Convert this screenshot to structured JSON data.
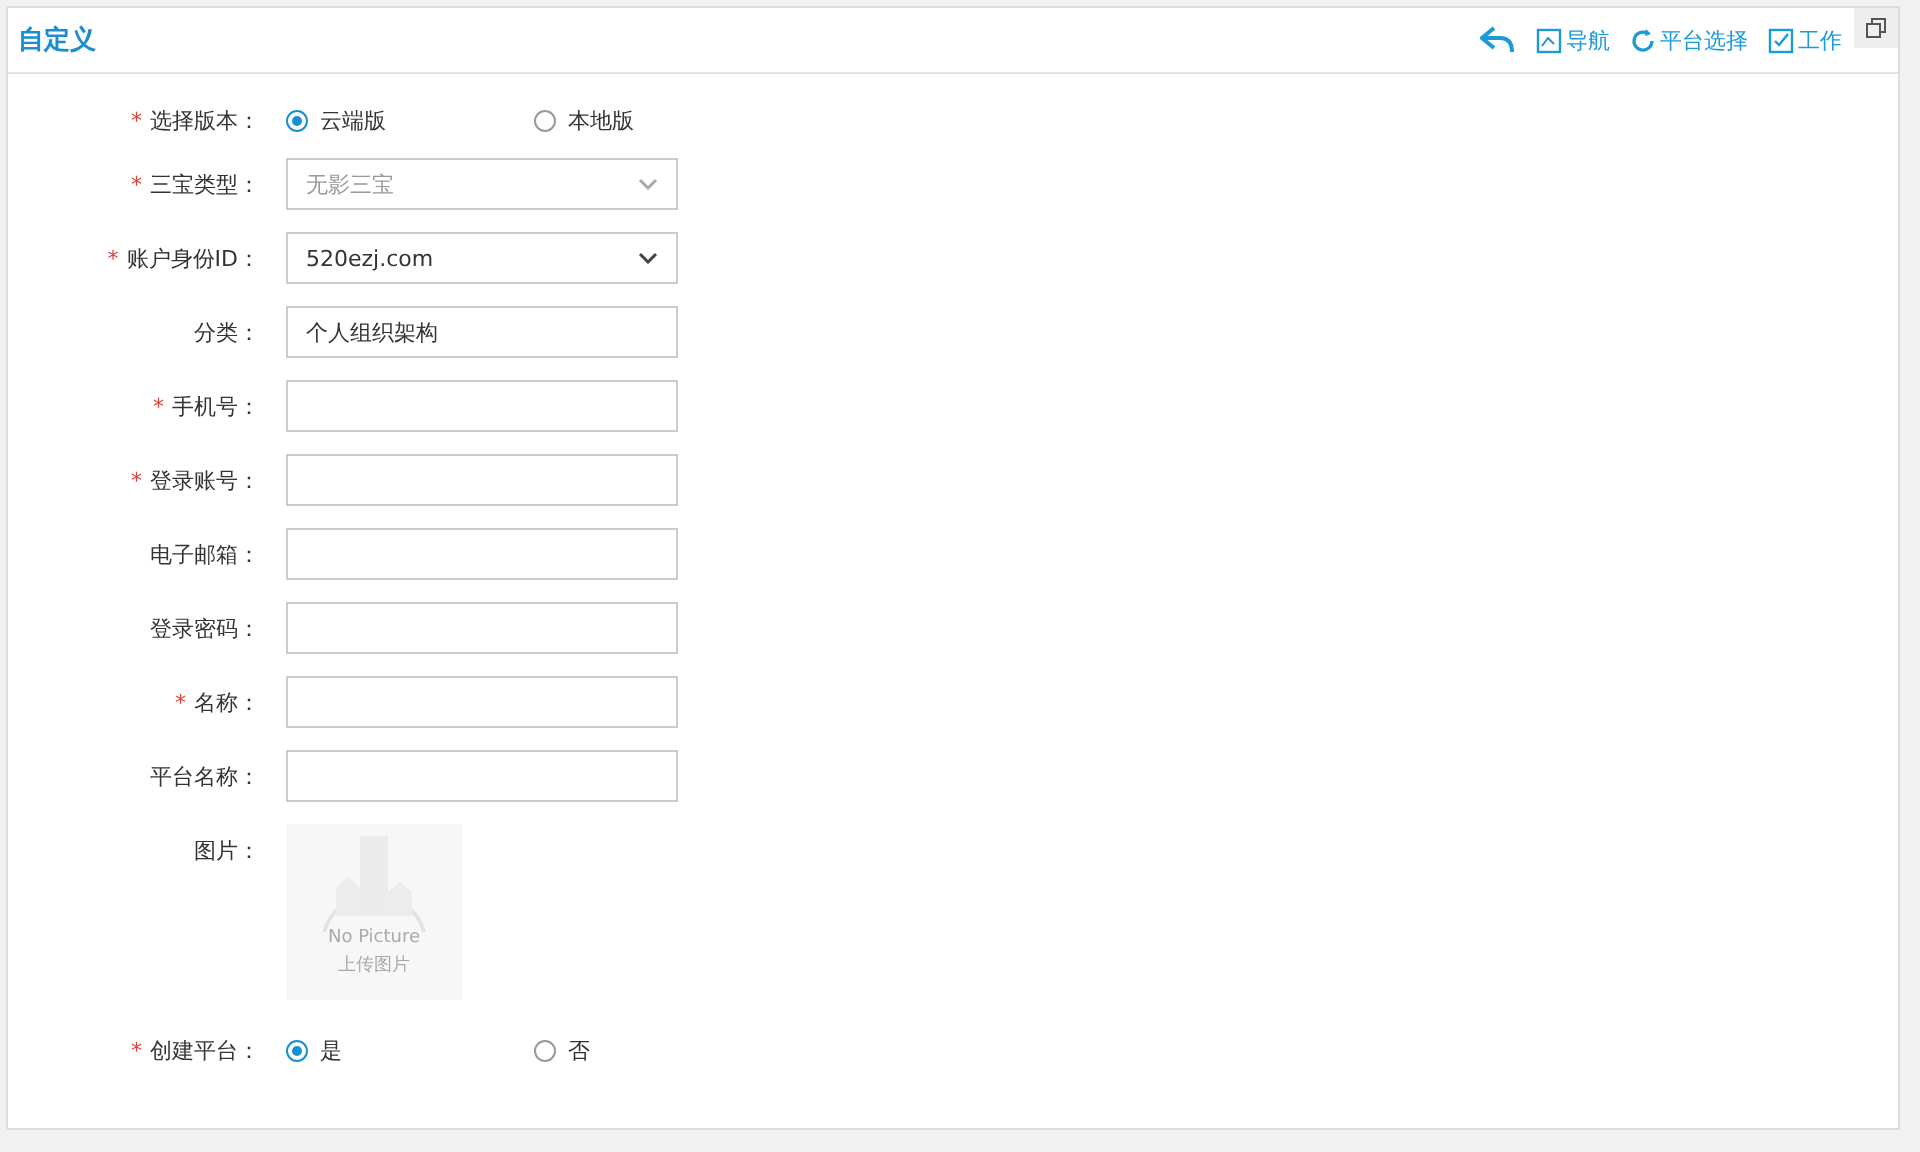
{
  "panel": {
    "title": "自定义",
    "toolbar": [
      {
        "kind": "back"
      },
      {
        "kind": "nav",
        "label": "导航"
      },
      {
        "kind": "refresh",
        "label": "平台选择"
      },
      {
        "kind": "edit",
        "label": "工作"
      }
    ]
  },
  "form": [
    {
      "kind": "radio",
      "required_mark": "*",
      "label": "选择版本：",
      "options": [
        {
          "label": "云端版",
          "selected": true
        },
        {
          "label": "本地版",
          "selected": false
        }
      ]
    },
    {
      "kind": "select",
      "required_mark": "*",
      "label": "三宝类型：",
      "value": "无影三宝",
      "disabled": true
    },
    {
      "kind": "select",
      "required_mark": "*",
      "label": "账户身份ID：",
      "value": "520ezj.com",
      "disabled": false
    },
    {
      "kind": "text",
      "label": "分类：",
      "value": "个人组织架构"
    },
    {
      "kind": "text",
      "required_mark": "*",
      "label": "手机号："
    },
    {
      "kind": "text",
      "required_mark": "*",
      "label": "登录账号："
    },
    {
      "kind": "text",
      "label": "电子邮箱："
    },
    {
      "kind": "text",
      "label": "登录密码："
    },
    {
      "kind": "text",
      "required_mark": "*",
      "label": "名称："
    },
    {
      "kind": "text",
      "label": "平台名称："
    },
    {
      "kind": "image",
      "label": "图片：",
      "caption": "No  Picture",
      "hint": "上传图片"
    },
    {
      "kind": "radio",
      "required_mark": "*",
      "label": "创建平台：",
      "options": [
        {
          "label": "是",
          "selected": true
        },
        {
          "label": "否",
          "selected": false
        }
      ]
    }
  ]
}
